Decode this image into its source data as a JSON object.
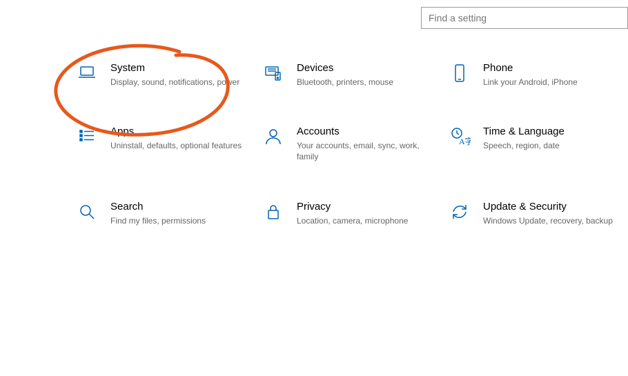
{
  "search": {
    "placeholder": "Find a setting"
  },
  "tiles": {
    "system": {
      "title": "System",
      "desc": "Display, sound, notifications, power"
    },
    "devices": {
      "title": "Devices",
      "desc": "Bluetooth, printers, mouse"
    },
    "phone": {
      "title": "Phone",
      "desc": "Link your Android, iPhone"
    },
    "apps": {
      "title": "Apps",
      "desc": "Uninstall, defaults, optional features"
    },
    "accounts": {
      "title": "Accounts",
      "desc": "Your accounts, email, sync, work, family"
    },
    "time": {
      "title": "Time & Language",
      "desc": "Speech, region, date"
    },
    "search": {
      "title": "Search",
      "desc": "Find my files, permissions"
    },
    "privacy": {
      "title": "Privacy",
      "desc": "Location, camera, microphone"
    },
    "update": {
      "title": "Update & Security",
      "desc": "Windows Update, recovery, backup"
    }
  }
}
